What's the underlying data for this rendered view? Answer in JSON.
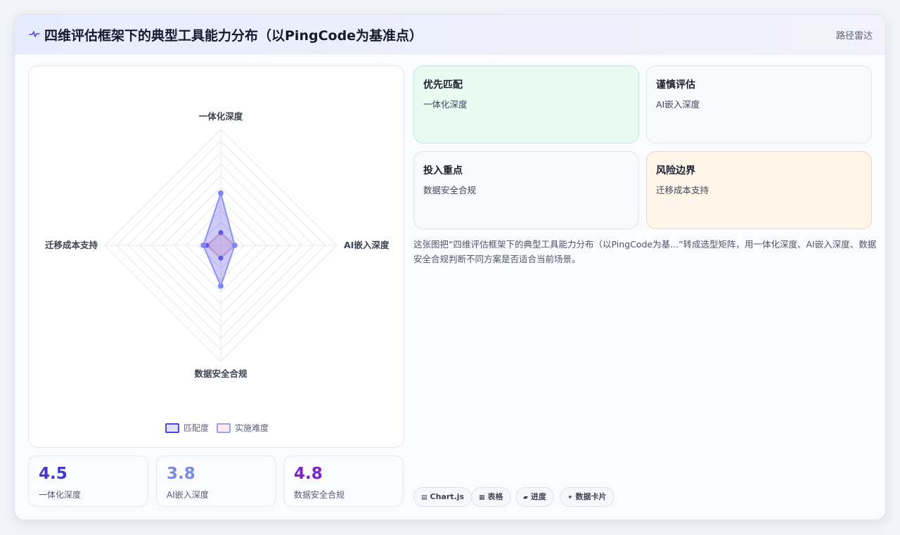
{
  "header": {
    "title": "四维评估框架下的典型工具能力分布（以PingCode为基准点）",
    "route_label": "路径雷达",
    "icon": "pulse-icon"
  },
  "chart_data": {
    "type": "radar",
    "title": "",
    "axes": [
      "一体化深度",
      "AI嵌入深度",
      "数据安全合规",
      "迁移成本支持"
    ],
    "series": [
      {
        "name": "匹配度",
        "values": [
          4.5,
          1.2,
          3.5,
          1.5
        ],
        "color": "#4f46e5"
      },
      {
        "name": "实施难度",
        "values": [
          1.1,
          1.2,
          1.1,
          1.2
        ],
        "color": "#e8b4c8"
      }
    ],
    "rmax": 10,
    "grid_levels": 10,
    "legend_position": "bottom"
  },
  "stats": [
    {
      "value": "4.5",
      "label": "一体化深度",
      "color": "#4338ca"
    },
    {
      "value": "3.8",
      "label": "AI嵌入深度",
      "color": "#7c8ae0"
    },
    {
      "value": "4.8",
      "label": "数据安全合规",
      "color": "#7e22ce"
    }
  ],
  "tiles": [
    {
      "title": "优先匹配",
      "subtitle": "一体化深度"
    },
    {
      "title": "谨慎评估",
      "subtitle": "AI嵌入深度"
    },
    {
      "title": "投入重点",
      "subtitle": "数据安全合规"
    },
    {
      "title": "风险边界",
      "subtitle": "迁移成本支持"
    }
  ],
  "description": "这张图把“四维评估框架下的典型工具能力分布（以PingCode为基...”转成选型矩阵，用一体化深度、AI嵌入深度、数据安全合规判断不同方案是否适合当前场景。",
  "tags": [
    {
      "icon": "▤",
      "label": "Chart.js"
    },
    {
      "icon": "▦",
      "label": "表格"
    },
    {
      "icon": "▰",
      "label": "进度"
    },
    {
      "icon": "✦",
      "label": "数据卡片"
    }
  ]
}
